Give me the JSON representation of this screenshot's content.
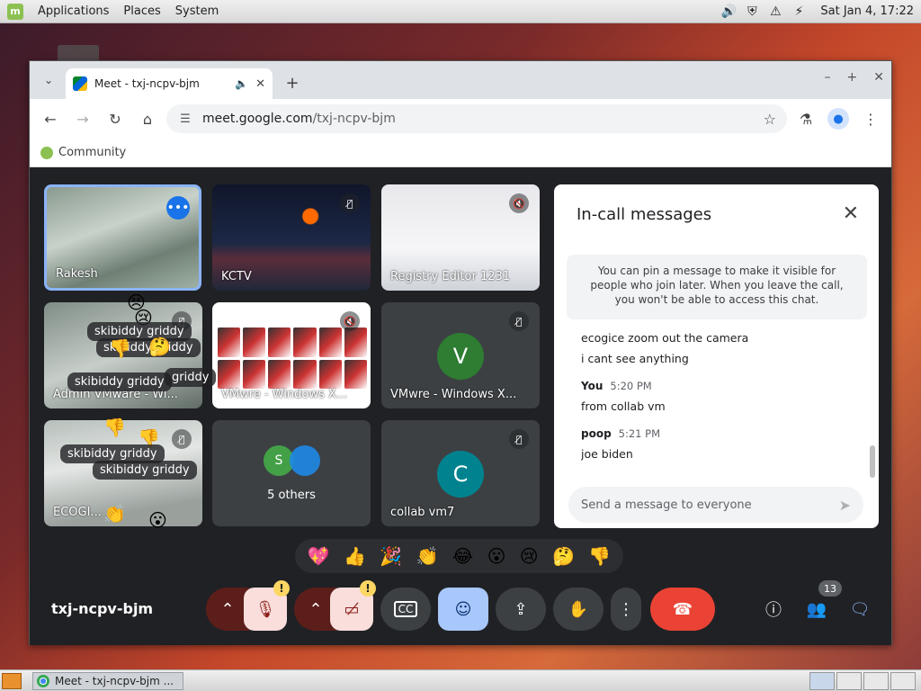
{
  "top_panel": {
    "menus": [
      "Applications",
      "Places",
      "System"
    ],
    "clock": "Sat Jan  4, 17:22"
  },
  "browser": {
    "tab": {
      "title": "Meet - txj-ncpv-bjm"
    },
    "url": {
      "host": "meet.google.com",
      "path": "/txj-ncpv-bjm"
    },
    "bookmark": "Community"
  },
  "tiles": [
    {
      "name": "Rakesh"
    },
    {
      "name": "KCTV"
    },
    {
      "name": "Registry Editor 1231"
    },
    {
      "name": "Admin VMware - Wi..."
    },
    {
      "name": "VMwre - Windows X..."
    },
    {
      "name": "VMwre - Windows X..."
    },
    {
      "name": "ECOGI..."
    },
    {
      "name": "5 others"
    },
    {
      "name": "collab vm7"
    }
  ],
  "avatars": {
    "v": "V",
    "s": "S",
    "c": "C",
    "colors": {
      "v": "#2e7d32",
      "s": "#43a047",
      "c": "#00838f"
    }
  },
  "bubbles": {
    "skibiddy": "skibiddy griddy",
    "griddy": "griddy"
  },
  "chat": {
    "title": "In-call messages",
    "pin_note": "You can pin a message to make it visible for people who join later. When you leave the call, you won't be able to access this chat.",
    "messages": [
      {
        "text": "ecogice zoom out the camera"
      },
      {
        "text": "i cant see anything"
      },
      {
        "sender": "You",
        "time": "5:20 PM",
        "text": "from collab vm"
      },
      {
        "sender": "poop",
        "time": "5:21 PM",
        "text": "joe biden"
      }
    ],
    "composer_placeholder": "Send a message to everyone"
  },
  "reactions": [
    "💖",
    "👍",
    "🎉",
    "👏",
    "😂",
    "😮",
    "😢",
    "🤔",
    "👎"
  ],
  "controls": {
    "meeting_code": "txj-ncpv-bjm",
    "participants_count": "13"
  },
  "taskbar": {
    "window_title": "Meet - txj-ncpv-bjm ..."
  }
}
